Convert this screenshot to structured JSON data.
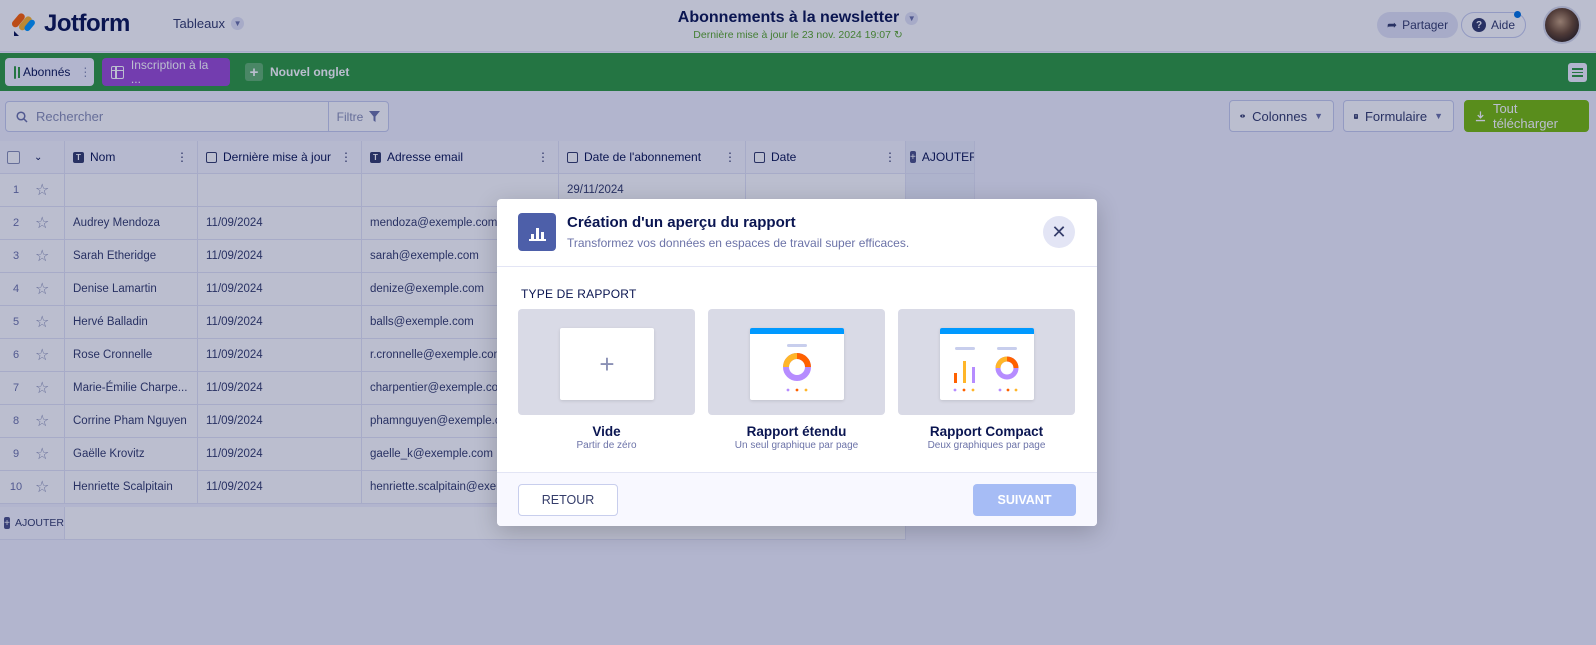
{
  "app": {
    "logo_text": "Jotform",
    "tables_menu": "Tableaux",
    "title": "Abonnements à la newsletter",
    "last_update": "Dernière mise à jour le 23 nov. 2024 19:07",
    "share_label": "Partager",
    "help_label": "Aide"
  },
  "tabs": {
    "active": "Abonnés",
    "second": "Inscription à la ...",
    "new_tab": "Nouvel onglet"
  },
  "toolbar": {
    "search_placeholder": "Rechercher",
    "filter_label": "Filtre",
    "columns_label": "Colonnes",
    "form_label": "Formulaire",
    "download_label": "Tout télécharger"
  },
  "table": {
    "headers": {
      "name": "Nom",
      "updated": "Dernière mise à jour",
      "email": "Adresse email",
      "subscribed": "Date de l'abonnement",
      "date": "Date",
      "add_column": "AJOUTER"
    },
    "rows": [
      {
        "num": "1",
        "name": "",
        "updated": "",
        "email": "",
        "subscribed": "29/11/2024",
        "date": ""
      },
      {
        "num": "2",
        "name": "Audrey Mendoza",
        "updated": "11/09/2024",
        "email": "mendoza@exemple.com",
        "subscribed": "",
        "date": ""
      },
      {
        "num": "3",
        "name": "Sarah Etheridge",
        "updated": "11/09/2024",
        "email": "sarah@exemple.com",
        "subscribed": "",
        "date": ""
      },
      {
        "num": "4",
        "name": "Denise Lamartin",
        "updated": "11/09/2024",
        "email": "denize@exemple.com",
        "subscribed": "",
        "date": ""
      },
      {
        "num": "5",
        "name": "Hervé Balladin",
        "updated": "11/09/2024",
        "email": "balls@exemple.com",
        "subscribed": "",
        "date": ""
      },
      {
        "num": "6",
        "name": "Rose Cronnelle",
        "updated": "11/09/2024",
        "email": "r.cronnelle@exemple.com",
        "subscribed": "",
        "date": ""
      },
      {
        "num": "7",
        "name": "Marie-Émilie Charpe...",
        "updated": "11/09/2024",
        "email": "charpentier@exemple.com",
        "subscribed": "",
        "date": ""
      },
      {
        "num": "8",
        "name": "Corrine Pham Nguyen",
        "updated": "11/09/2024",
        "email": "phamnguyen@exemple.com",
        "subscribed": "",
        "date": ""
      },
      {
        "num": "9",
        "name": "Gaëlle Krovitz",
        "updated": "11/09/2024",
        "email": "gaelle_k@exemple.com",
        "subscribed": "",
        "date": ""
      },
      {
        "num": "10",
        "name": "Henriette Scalpitain",
        "updated": "11/09/2024",
        "email": "henriette.scalpitain@exemple.com",
        "subscribed": "",
        "date": ""
      }
    ],
    "add_row": "AJOUTER"
  },
  "modal": {
    "title": "Création d'un aperçu du rapport",
    "subtitle": "Transformez vos données en espaces de travail super efficaces.",
    "section_label": "TYPE DE RAPPORT",
    "options": [
      {
        "label": "Vide",
        "desc": "Partir de zéro"
      },
      {
        "label": "Rapport étendu",
        "desc": "Un seul graphique par page"
      },
      {
        "label": "Rapport Compact",
        "desc": "Deux graphiques par page"
      }
    ],
    "back_label": "RETOUR",
    "next_label": "SUIVANT"
  },
  "colors": {
    "tabbar": "#2f9a3e",
    "purple_tab": "#9c4dd3",
    "download": "#78bb07",
    "accent_blue": "#0099ff",
    "next_disabled": "#a6bcf5"
  },
  "icons": [
    "jotform-logo-icon",
    "chevron-down-icon",
    "share-icon",
    "help-icon",
    "grid-icon",
    "plus-icon",
    "menu-icon",
    "search-icon",
    "filter-icon",
    "eye-icon",
    "form-icon",
    "download-icon",
    "star-icon",
    "text-type-icon",
    "calendar-icon",
    "close-icon",
    "bar-chart-icon"
  ]
}
